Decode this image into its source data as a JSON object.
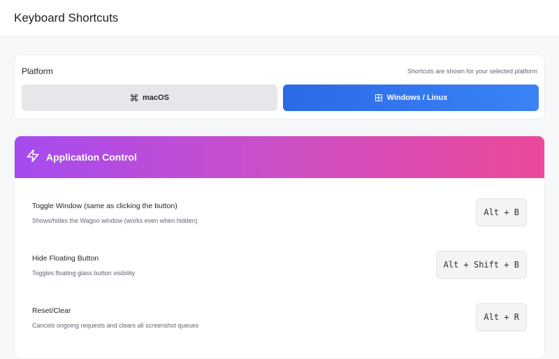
{
  "header": {
    "title": "Keyboard Shortcuts"
  },
  "platform": {
    "title": "Platform",
    "hint": "Shortcuts are shown for your selected platform",
    "options": [
      {
        "label": "macOS",
        "icon": "command-icon",
        "selected": false
      },
      {
        "label": "Windows / Linux",
        "icon": "windows-grid-icon",
        "selected": true
      }
    ]
  },
  "sections": [
    {
      "title": "Application Control",
      "icon": "lightning-icon",
      "colors": {
        "gradient_start": "#a64bf0",
        "gradient_end": "#ec4899"
      },
      "shortcuts": [
        {
          "title": "Toggle Window (same as clicking the button)",
          "description": "Shows/hides the Wagoo window (works even when hidden)",
          "keys": "Alt + B"
        },
        {
          "title": "Hide Floating Button",
          "description": "Toggles floating glass button visibility",
          "keys": "Alt + Shift + B"
        },
        {
          "title": "Reset/Clear",
          "description": "Cancels ongoing requests and clears all screenshot queues",
          "keys": "Alt + R"
        }
      ]
    }
  ],
  "colors": {
    "accent": "#3b82f6",
    "unselected": "#e6e7ea"
  }
}
